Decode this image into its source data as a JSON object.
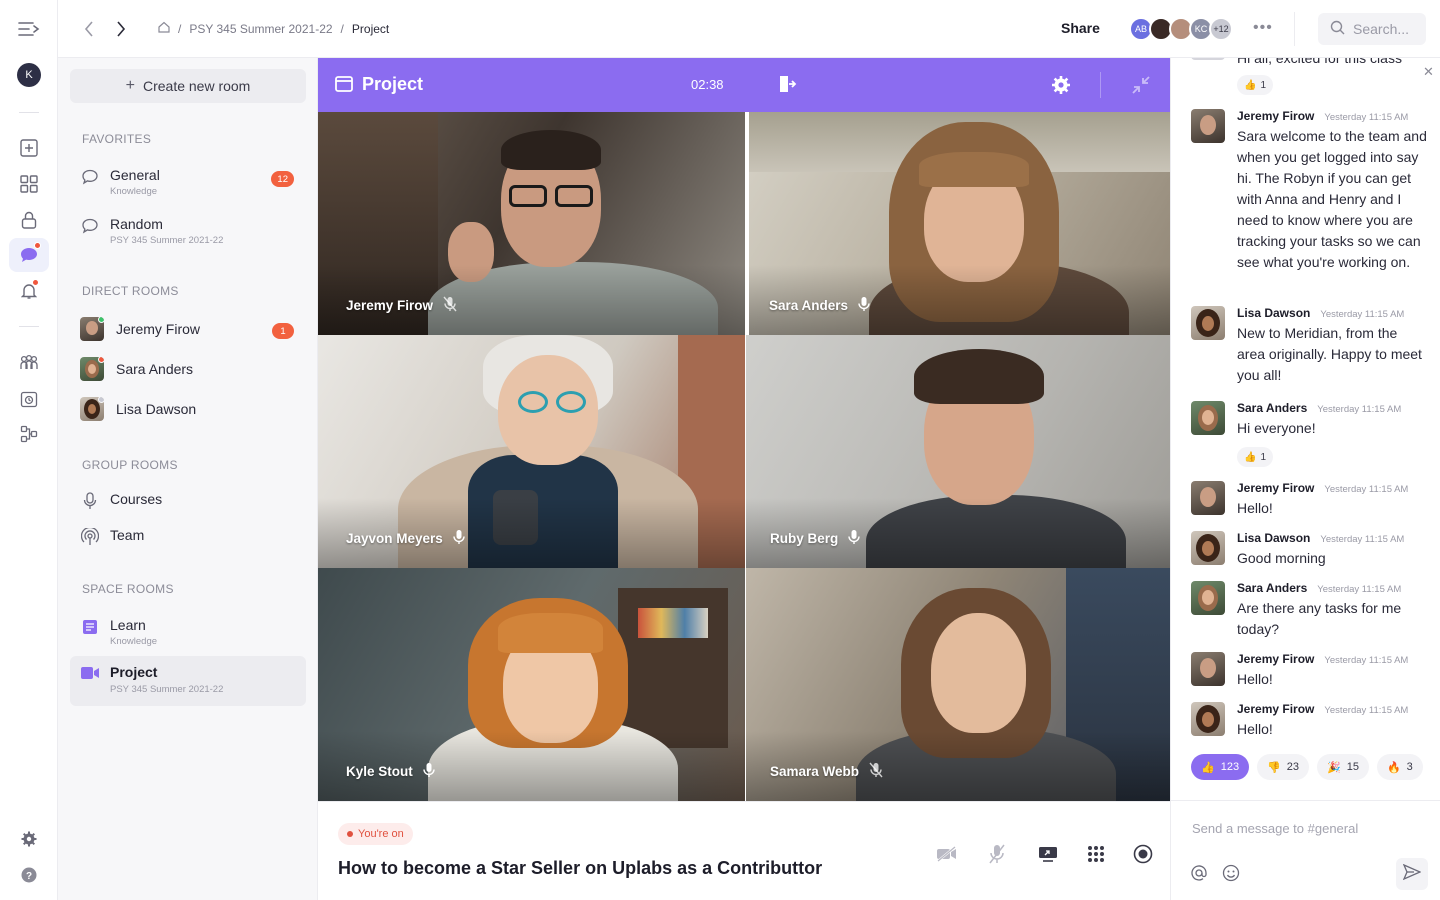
{
  "user": {
    "initial": "K"
  },
  "breadcrumb": {
    "parent": "PSY 345 Summer 2021-22",
    "current": "Project"
  },
  "header": {
    "share_label": "Share",
    "avatars": [
      {
        "initials": "AB",
        "color": "#6b6fe0"
      },
      {
        "initials": "",
        "color": "#3a2a26"
      },
      {
        "initials": "",
        "color": "#b58e7c"
      },
      {
        "initials": "KC",
        "color": "#8b8fa6"
      },
      {
        "initials": "+12",
        "color": "#c8c9d2"
      }
    ],
    "more_label": "•••",
    "search_placeholder": "Search..."
  },
  "sidebar": {
    "create_label": "Create new room",
    "favorites_heading": "FAVORITES",
    "favorites": [
      {
        "name": "General",
        "sub": "Knowledge",
        "badge": "12"
      },
      {
        "name": "Random",
        "sub": "PSY 345 Summer 2021-22",
        "badge": ""
      }
    ],
    "direct_heading": "DIRECT ROOMS",
    "direct": [
      {
        "name": "Jeremy Firow",
        "badge": "1",
        "status_color": "#3cc36a"
      },
      {
        "name": "Sara Anders",
        "badge": "",
        "status_color": "#f0573d"
      },
      {
        "name": "Lisa Dawson",
        "badge": "",
        "status_color": "#c8c9d2"
      }
    ],
    "group_heading": "GROUP ROOMS",
    "group": [
      {
        "name": "Courses"
      },
      {
        "name": "Team"
      }
    ],
    "space_heading": "SPACE ROOMS",
    "space": [
      {
        "name": "Learn",
        "sub": "Knowledge"
      },
      {
        "name": "Project",
        "sub": "PSY 345 Summer 2021-22"
      }
    ]
  },
  "call": {
    "title": "Project",
    "timer": "02:38",
    "participants": [
      {
        "name": "Jeremy Firow",
        "mic": "muted"
      },
      {
        "name": "Sara Anders",
        "mic": "on"
      },
      {
        "name": "Jayvon Meyers",
        "mic": "on"
      },
      {
        "name": "Ruby Berg",
        "mic": "on"
      },
      {
        "name": "Kyle Stout",
        "mic": "on"
      },
      {
        "name": "Samara Webb",
        "mic": "muted"
      }
    ],
    "status_badge": "You're on",
    "talk_title": "How to become a Star Seller on Uplabs as a Contributtor"
  },
  "chat": {
    "top_partial_text": "Hi all, excited for this class",
    "top_reaction": {
      "emoji": "👍",
      "count": "1"
    },
    "messages": [
      {
        "author": "Jeremy Firow",
        "time": "Yesterday 11:15 AM",
        "text": "Sara welcome to the team and when you get logged into say hi. The Robyn if you can get with Anna and Henry and I need to know where you are tracking your tasks so we can see what you're working on."
      },
      {
        "author": "Lisa Dawson",
        "time": "Yesterday 11:15 AM",
        "text": "New to Meridian, from the area originally. Happy to meet you all!"
      },
      {
        "author": "Sara Anders",
        "time": "Yesterday 11:15 AM",
        "text": "Hi everyone!"
      },
      {
        "author": "Jeremy Firow",
        "time": "Yesterday 11:15 AM",
        "text": "Hello!"
      },
      {
        "author": "Lisa Dawson",
        "time": "Yesterday 11:15 AM",
        "text": "Good morning"
      },
      {
        "author": "Sara Anders",
        "time": "Yesterday 11:15 AM",
        "text": "Are there any tasks for me today?"
      },
      {
        "author": "Jeremy Firow",
        "time": "Yesterday 11:15 AM",
        "text": "Hello!"
      },
      {
        "author": "Jeremy Firow",
        "time": "Yesterday 11:15 AM",
        "text": "Hello!"
      }
    ],
    "inline_reaction": {
      "emoji": "👍",
      "count": "1"
    },
    "reaction_bar": [
      {
        "emoji": "👍",
        "count": "123"
      },
      {
        "emoji": "👎",
        "count": "23"
      },
      {
        "emoji": "🎉",
        "count": "15"
      },
      {
        "emoji": "🔥",
        "count": "3"
      }
    ],
    "composer_placeholder": "Send a message to #general",
    "close_label": "✕"
  },
  "colors": {
    "accent": "#8b6cf0",
    "badge": "#f2613f",
    "speaking": "#4fc27a"
  }
}
